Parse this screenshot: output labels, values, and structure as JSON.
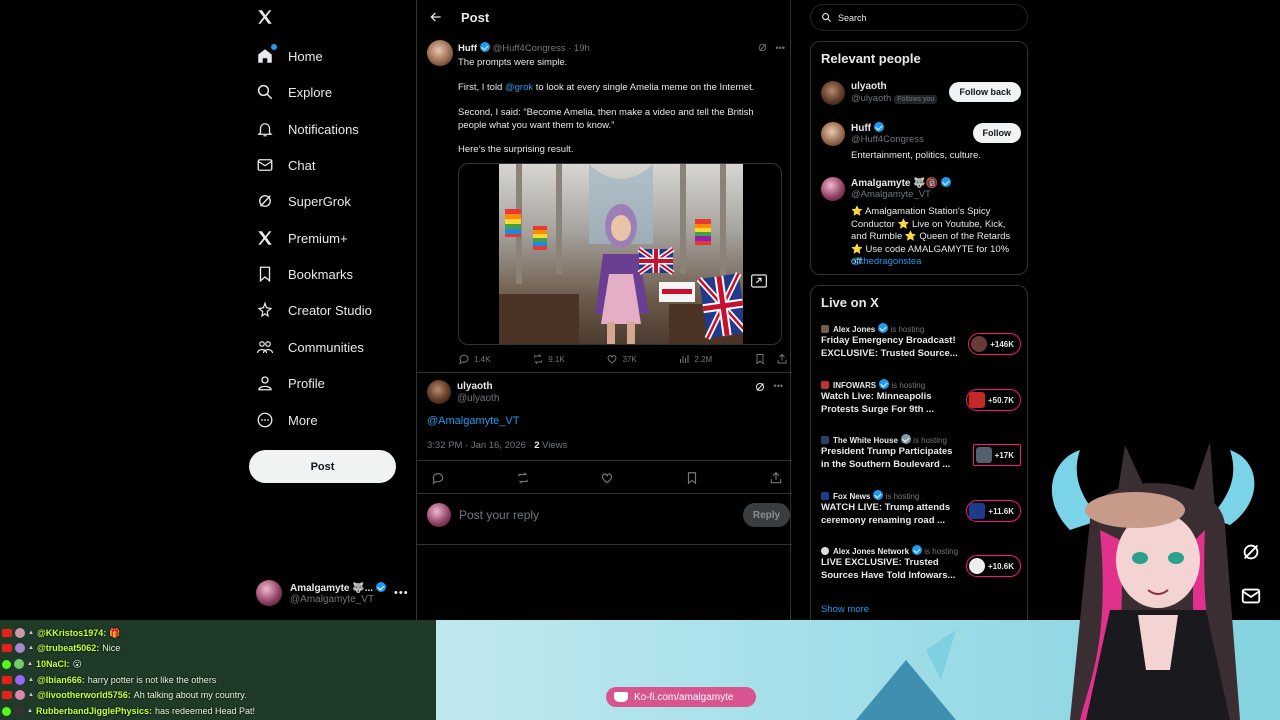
{
  "nav": {
    "items": [
      {
        "label": "Home",
        "icon": "home-icon"
      },
      {
        "label": "Explore",
        "icon": "search-icon"
      },
      {
        "label": "Notifications",
        "icon": "bell-icon"
      },
      {
        "label": "Chat",
        "icon": "mail-icon"
      },
      {
        "label": "SuperGrok",
        "icon": "grok-icon"
      },
      {
        "label": "Premium+",
        "icon": "x-logo-icon"
      },
      {
        "label": "Bookmarks",
        "icon": "bookmark-icon"
      },
      {
        "label": "Creator Studio",
        "icon": "creator-icon"
      },
      {
        "label": "Communities",
        "icon": "communities-icon"
      },
      {
        "label": "Profile",
        "icon": "person-icon"
      },
      {
        "label": "More",
        "icon": "more-circle-icon"
      }
    ],
    "post_button": "Post",
    "account": {
      "name": "Amalgamyte 🐺...",
      "handle": "@Amalgamyte_VT"
    }
  },
  "main": {
    "title": "Post",
    "quoted": {
      "author": "Huff",
      "handle": "@Huff4Congress",
      "time": "· 19h",
      "line1": "The prompts were simple.",
      "line2_pre": "First, I told ",
      "line2_mention": "@grok",
      "line2_post": " to look at every single Amelia meme on the Internet.",
      "line3": "Second, I said: “Become Amelia, then make a video and tell the British people what you want them to know.”",
      "line4": "Here’s the surprising result.",
      "replies": "1.4K",
      "reposts": "9.1K",
      "likes": "37K",
      "views": "2.2M"
    },
    "reply": {
      "author": "ulyaoth",
      "handle": "@ulyaoth",
      "text": "@Amalgamyte_VT",
      "meta_time": "3:32 PM · Jan 16, 2026 · ",
      "meta_views_count": "2",
      "meta_views_label": " Views"
    },
    "compose_placeholder": "Post your reply",
    "reply_button": "Reply"
  },
  "right": {
    "search_placeholder": "Search",
    "relevant": {
      "title": "Relevant people",
      "people": [
        {
          "name": "ulyaoth",
          "handle": "@ulyaoth",
          "follows_you": "Follows you",
          "button": "Follow back",
          "bio": ""
        },
        {
          "name": "Huff",
          "handle": "@Huff4Congress",
          "button": "Follow",
          "bio": "Entertainment, politics, culture."
        },
        {
          "name": "Amalgamyte 🐺🔞",
          "handle": "@Amalgamyte_VT",
          "bio": "⭐ Amalgamation Station's Spicy Conductor ⭐ Live on Youtube, Kick, and Rumble ⭐ Queen of the Retards ⭐ Use code AMALGAMYTE for 10% off",
          "bio_link": "@thedragonstea"
        }
      ]
    },
    "live": {
      "title": "Live on X",
      "hosting_label": "is hosting",
      "items": [
        {
          "host": "Alex Jones",
          "title": "Friday Emergency Broadcast! EXCLUSIVE: Trusted Source...",
          "count": "+146K"
        },
        {
          "host": "INFOWARS",
          "title": "Watch Live: Minneapolis Protests Surge For 9th ...",
          "count": "+50.7K"
        },
        {
          "host": "The White House",
          "title": "President Trump Participates in the Southern Boulevard ...",
          "count": "+17K"
        },
        {
          "host": "Fox News",
          "title": "WATCH LIVE: Trump attends ceremony renaming road ...",
          "count": "+11.6K"
        },
        {
          "host": "Alex Jones Network",
          "title": "LIVE EXCLUSIVE: Trusted Sources Have Told Infowars...",
          "count": "+10.6K"
        }
      ],
      "show_more": "Show more"
    }
  },
  "stream": {
    "chat": [
      {
        "name": "@KKristos1974:",
        "msg": "🎁",
        "platform": "youtube"
      },
      {
        "name": "@trubeat5062:",
        "msg": "Nice",
        "platform": "youtube"
      },
      {
        "name": "10NaCl:",
        "msg": "😮",
        "platform": "kick"
      },
      {
        "name": "@Ibian666:",
        "msg": "harry potter is not like the others",
        "platform": "youtube"
      },
      {
        "name": "@livootherworld5756:",
        "msg": "Ah talking about my country.",
        "platform": "youtube"
      },
      {
        "name": "RubberbandJigglePhysics:",
        "msg": "has redeemed Head Pat!",
        "platform": "kick"
      }
    ],
    "kofi": "Ko-fi.com/amalgamyte"
  }
}
